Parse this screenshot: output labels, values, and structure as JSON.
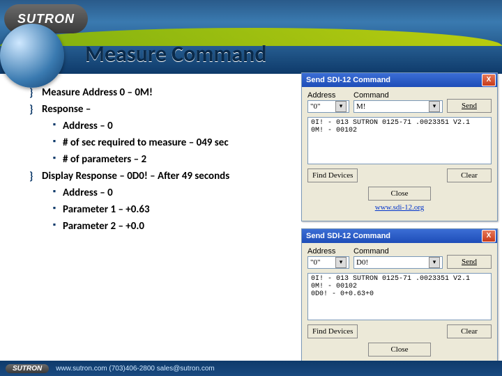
{
  "header": {
    "brand": "SUTRON",
    "title": "Measure Command"
  },
  "bullets": {
    "i0": "Measure Address 0 – 0M!",
    "i1": "Response –",
    "i1a": "Address – 0",
    "i1b": "# of sec required to measure – 049 sec",
    "i1c": "# of parameters – 2",
    "i2": "Display Response – 0D0! – After 49 seconds",
    "i2a": "Address – 0",
    "i2b": "Parameter 1 – +0.63",
    "i2c": "Parameter 2 – +0.0"
  },
  "dlg": {
    "title": "Send SDI-12 Command",
    "close": "X",
    "addr_lbl": "Address",
    "cmd_lbl": "Command",
    "send": "Send",
    "find": "Find Devices",
    "clear": "Clear",
    "closebtn": "Close",
    "link": "www.sdi-12.org"
  },
  "d1": {
    "addr": "\"0\"",
    "cmd": "M!",
    "out": "0I! - 013 SUTRON 0125-71 .0023351 V2.1\n0M! - 00102"
  },
  "d2": {
    "addr": "\"0\"",
    "cmd": "D0!",
    "out": "0I! - 013 SUTRON 0125-71 .0023351 V2.1\n0M! - 00102\n0D0! - 0+0.63+0"
  },
  "footer": {
    "brand": "SUTRON",
    "text": "www.sutron.com   (703)406-2800   sales@sutron.com"
  }
}
